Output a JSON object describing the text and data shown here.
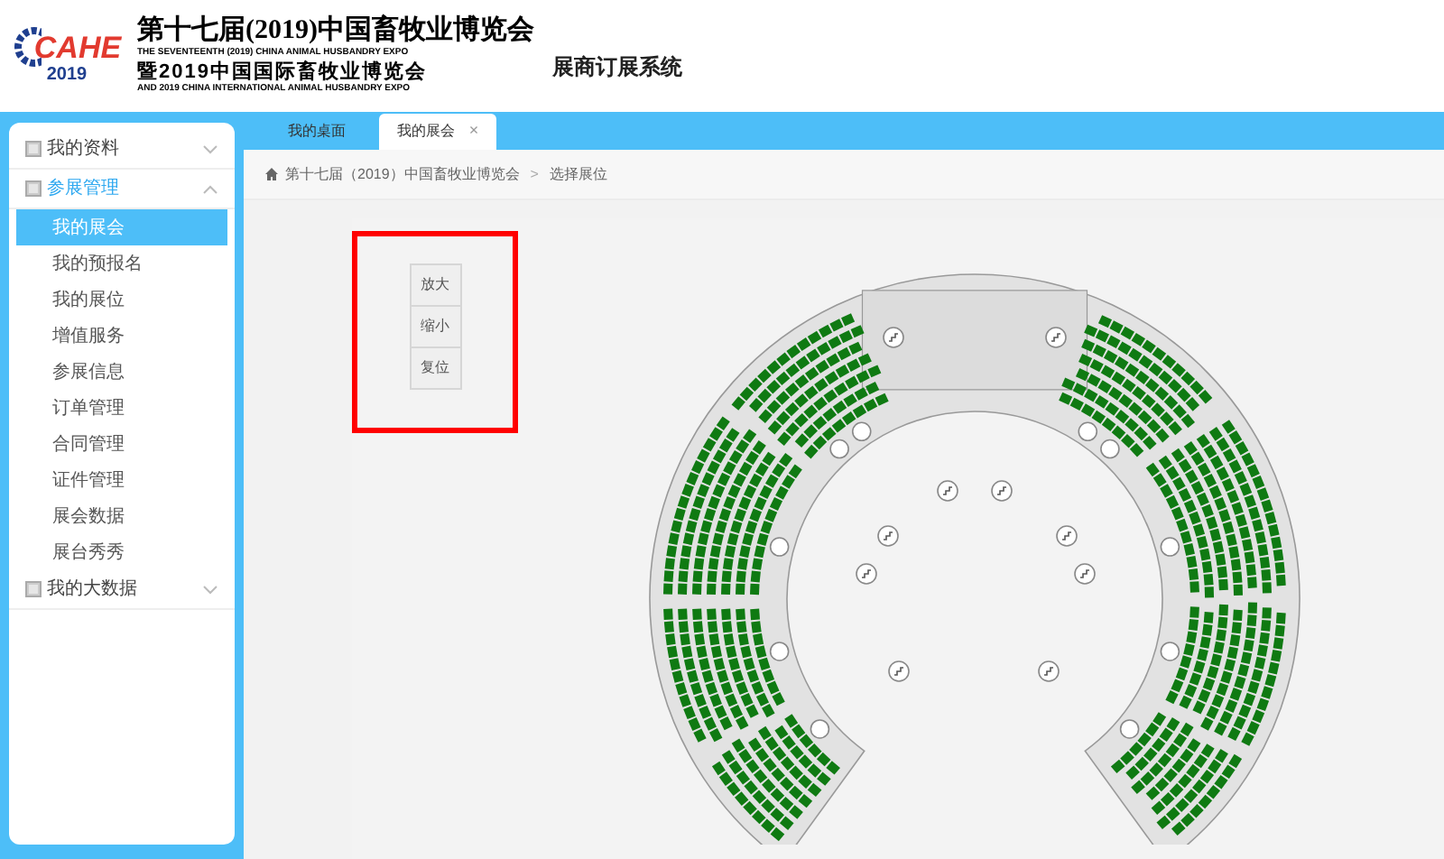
{
  "header": {
    "logo": {
      "letters": "CAHE",
      "year": "2019"
    },
    "title_cn": "第十七届(2019)中国畜牧业博览会",
    "title_en": "THE SEVENTEENTH (2019) CHINA ANIMAL HUSBANDRY EXPO",
    "subtitle_cn": "暨2019中国国际畜牧业博览会",
    "subtitle_en": "AND 2019 CHINA INTERNATIONAL ANIMAL HUSBANDRY EXPO",
    "system_name": "展商订展系统"
  },
  "sidebar": {
    "groups": [
      {
        "label": "我的资料",
        "expanded": false
      },
      {
        "label": "参展管理",
        "expanded": true,
        "children": [
          {
            "label": "我的展会",
            "selected": true
          },
          {
            "label": "我的预报名",
            "selected": false
          },
          {
            "label": "我的展位",
            "selected": false
          },
          {
            "label": "增值服务",
            "selected": false
          },
          {
            "label": "参展信息",
            "selected": false
          },
          {
            "label": "订单管理",
            "selected": false
          },
          {
            "label": "合同管理",
            "selected": false
          },
          {
            "label": "证件管理",
            "selected": false
          },
          {
            "label": "展会数据",
            "selected": false
          },
          {
            "label": "展台秀秀",
            "selected": false
          }
        ]
      },
      {
        "label": "我的大数据",
        "expanded": false
      }
    ]
  },
  "tabs": [
    {
      "label": "我的桌面",
      "selected": false,
      "closable": false
    },
    {
      "label": "我的展会",
      "selected": true,
      "closable": true
    }
  ],
  "close_glyph": "×",
  "breadcrumb": {
    "items": [
      "第十七届（2019）中国畜牧业博览会",
      "选择展位"
    ],
    "separator": ">"
  },
  "zoom_controls": [
    "放大",
    "缩小",
    "复位"
  ]
}
